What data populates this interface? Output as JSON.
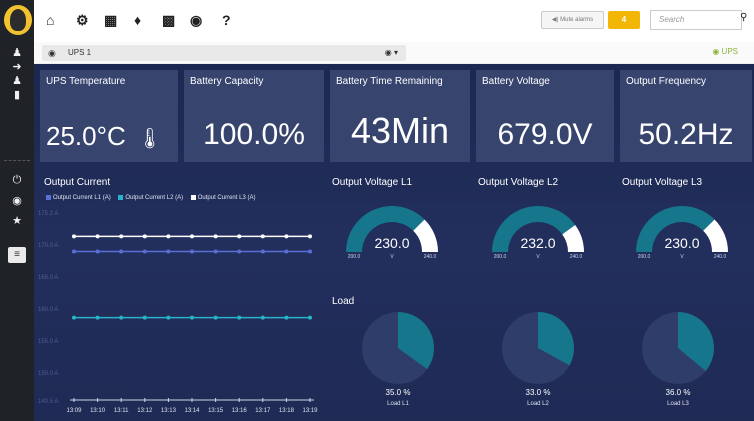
{
  "toolbar": {
    "icons": [
      "home-icon",
      "gear-icon",
      "grid-icon",
      "bell-icon",
      "qr-icon",
      "gauge-icon",
      "help-icon"
    ],
    "help_label": "?",
    "mute_label": "◀) Mute alarms",
    "alarm_count": "4",
    "search_placeholder": "Search"
  },
  "device": {
    "selected": "UPS 1",
    "status_label": "UPS"
  },
  "cards": [
    {
      "label": "UPS Temperature",
      "value": "25.0°C"
    },
    {
      "label": "Battery Capacity",
      "value": "100.0%"
    },
    {
      "label": "Battery Time Remaining",
      "value": "43Min"
    },
    {
      "label": "Battery Voltage",
      "value": "679.0V"
    },
    {
      "label": "Output Frequency",
      "value": "50.2Hz"
    }
  ],
  "colors": {
    "background": "#1f2a55",
    "card": "#37446e",
    "gauge_fill": "#16768c",
    "alarm": "#f2b705",
    "status_ok": "#8fb43b",
    "series_l1": "#5a6fd6",
    "series_l2": "#2ab3c8",
    "series_l3": "#ffffff"
  },
  "output_current": {
    "title": "Output Current"
  },
  "gauges": [
    {
      "title": "Output Voltage L1",
      "value": "230.0",
      "unit": "V",
      "min": "200.0",
      "max": "240.0",
      "fraction": 0.75
    },
    {
      "title": "Output Voltage L2",
      "value": "232.0",
      "unit": "V",
      "min": "200.0",
      "max": "240.0",
      "fraction": 0.8
    },
    {
      "title": "Output Voltage L3",
      "value": "230.0",
      "unit": "V",
      "min": "200.0",
      "max": "240.0",
      "fraction": 0.75
    }
  ],
  "load": {
    "title": "Load",
    "items": [
      {
        "value": "35.0 %",
        "label": "Load L1",
        "fraction": 0.35
      },
      {
        "value": "33.0 %",
        "label": "Load L2",
        "fraction": 0.33
      },
      {
        "value": "36.0 %",
        "label": "Load L3",
        "fraction": 0.36
      }
    ]
  },
  "chart_data": {
    "type": "line",
    "title": "Output Current",
    "x": [
      "13:09",
      "13:10",
      "13:11",
      "13:12",
      "13:13",
      "13:14",
      "13:15",
      "13:16",
      "13:17",
      "13:18",
      "13:19"
    ],
    "yticks": [
      "175.2 A",
      "170.0 A",
      "165.0 A",
      "160.0 A",
      "155.0 A",
      "150.0 A",
      "140.5 A"
    ],
    "ylim": [
      140.5,
      175.2
    ],
    "series": [
      {
        "name": "Output Current L1 (A)",
        "color": "#5a6fd6",
        "values": [
          167.9,
          167.9,
          167.9,
          167.9,
          167.9,
          167.9,
          167.9,
          167.9,
          167.9,
          167.9,
          167.9
        ]
      },
      {
        "name": "Output Current L2 (A)",
        "color": "#2ab3c8",
        "values": [
          155.7,
          155.7,
          155.7,
          155.7,
          155.7,
          155.7,
          155.7,
          155.7,
          155.7,
          155.7,
          155.7
        ]
      },
      {
        "name": "Output Current L3 (A)",
        "color": "#ffffff",
        "values": [
          170.7,
          170.7,
          170.7,
          170.7,
          170.7,
          170.7,
          170.7,
          170.7,
          170.7,
          170.7,
          170.7
        ]
      }
    ],
    "legend": "top-left",
    "grid": false
  }
}
